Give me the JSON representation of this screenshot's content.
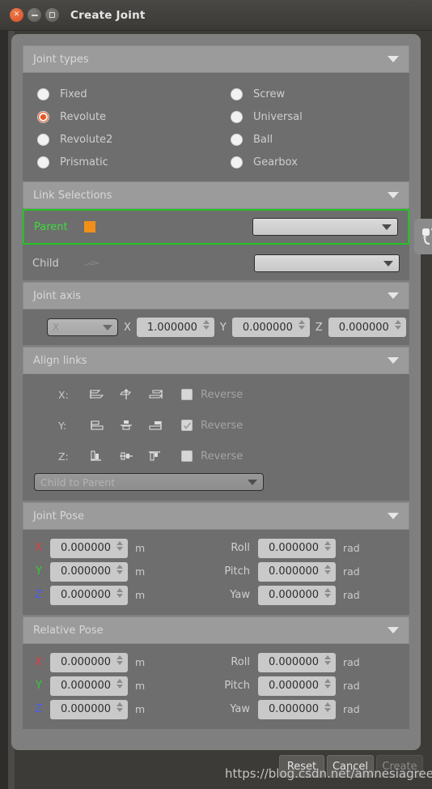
{
  "window": {
    "title": "Create Joint",
    "buttons": {
      "close": "close-button",
      "minimize": "minimize-button",
      "maximize": "maximize-button"
    }
  },
  "sections": {
    "joint_types": {
      "title": "Joint types",
      "options": [
        {
          "label": "Fixed",
          "selected": false
        },
        {
          "label": "Screw",
          "selected": false
        },
        {
          "label": "Revolute",
          "selected": true
        },
        {
          "label": "Universal",
          "selected": false
        },
        {
          "label": "Revolute2",
          "selected": false
        },
        {
          "label": "Ball",
          "selected": false
        },
        {
          "label": "Prismatic",
          "selected": false
        },
        {
          "label": "Gearbox",
          "selected": false
        }
      ]
    },
    "link_selections": {
      "title": "Link Selections",
      "parent_label": "Parent",
      "parent_value": "",
      "child_label": "Child",
      "child_value": "",
      "swap_button": "swap-links-button"
    },
    "joint_axis": {
      "title": "Joint axis",
      "preset": "X",
      "x_label": "X",
      "x_value": "1.000000",
      "y_label": "Y",
      "y_value": "0.000000",
      "z_label": "Z",
      "z_value": "0.000000"
    },
    "align_links": {
      "title": "Align links",
      "rows": [
        {
          "axis": "X:",
          "reverse_label": "Reverse",
          "reverse_checked": false
        },
        {
          "axis": "Y:",
          "reverse_label": "Reverse",
          "reverse_checked": true
        },
        {
          "axis": "Z:",
          "reverse_label": "Reverse",
          "reverse_checked": false
        }
      ],
      "direction": "Child to Parent"
    },
    "joint_pose": {
      "title": "Joint Pose",
      "rows": [
        {
          "axis": "X",
          "value": "0.000000",
          "unit": "m",
          "rot_label": "Roll",
          "rot_value": "0.000000",
          "rot_unit": "rad"
        },
        {
          "axis": "Y",
          "value": "0.000000",
          "unit": "m",
          "rot_label": "Pitch",
          "rot_value": "0.000000",
          "rot_unit": "rad"
        },
        {
          "axis": "Z",
          "value": "0.000000",
          "unit": "m",
          "rot_label": "Yaw",
          "rot_value": "0.000000",
          "rot_unit": "rad"
        }
      ]
    },
    "relative_pose": {
      "title": "Relative Pose",
      "rows": [
        {
          "axis": "X",
          "value": "0.000000",
          "unit": "m",
          "rot_label": "Roll",
          "rot_value": "0.000000",
          "rot_unit": "rad"
        },
        {
          "axis": "Y",
          "value": "0.000000",
          "unit": "m",
          "rot_label": "Pitch",
          "rot_value": "0.000000",
          "rot_unit": "rad"
        },
        {
          "axis": "Z",
          "value": "0.000000",
          "unit": "m",
          "rot_label": "Yaw",
          "rot_value": "0.000000",
          "rot_unit": "rad"
        }
      ]
    }
  },
  "footer": {
    "reset_label": "Reset",
    "cancel_label": "Cancel",
    "create_label": "Create"
  },
  "watermark": "https://blog.csdn.net/amnesiagreen",
  "colors": {
    "accent_orange": "#e95420",
    "selection_green": "#22c422",
    "parent_swatch": "#f08f1a",
    "axis_x": "#e23b3b",
    "axis_y": "#2fd12f",
    "axis_z": "#4a5cf5",
    "panel": "#7f7f7f",
    "section_header": "#9b9b9b",
    "section_body": "#6e6e6e"
  }
}
